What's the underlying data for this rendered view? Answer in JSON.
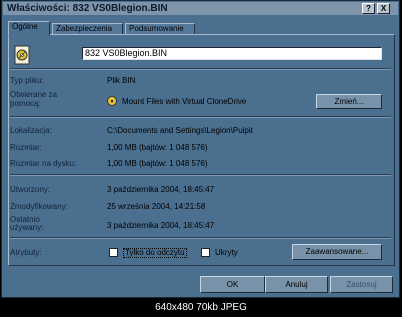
{
  "window": {
    "title": "Właściwości: 832 VS0Blegion.BIN"
  },
  "titlebar_buttons": {
    "help": "?",
    "close": "X"
  },
  "tabs": [
    {
      "label": "Ogólne"
    },
    {
      "label": "Zabezpieczenia"
    },
    {
      "label": "Podsumowanie"
    }
  ],
  "general": {
    "filename": "832 VS0Blegion.BIN",
    "type_label": "Typ pliku:",
    "type_value": "Plik BIN",
    "opens_label_1": "Otwierane za",
    "opens_label_2": "pomocą:",
    "opens_value": "Mount Files with Virtual CloneDrive",
    "change_button": "Zmień...",
    "location_label": "Lokalizacja:",
    "location_value": "C:\\Documents and Settings\\Legion\\Pulpit",
    "size_label": "Rozmiar:",
    "size_value": "1,00 MB (bajtów: 1 048 576)",
    "disk_size_label": "Rozmiar na dysku:",
    "disk_size_value": "1,00 MB (bajtów: 1 048 576)",
    "created_label": "Utworzony:",
    "created_value": "3 października 2004, 18:45:47",
    "modified_label": "Zmodyfikowany:",
    "modified_value": "25 września 2004, 14:21:58",
    "accessed_label_1": "Ostatnio",
    "accessed_label_2": "używany:",
    "accessed_value": "3 października 2004, 18:45:47",
    "attributes_label": "Atrybuty:",
    "readonly_label": "Tylko do odczytu",
    "hidden_label": "Ukryty",
    "advanced_button": "Zaawansowane..."
  },
  "buttons": {
    "ok": "OK",
    "cancel": "Anuluj",
    "apply": "Zastosuj"
  },
  "footer": {
    "caption": "640x480 70kb JPEG"
  }
}
